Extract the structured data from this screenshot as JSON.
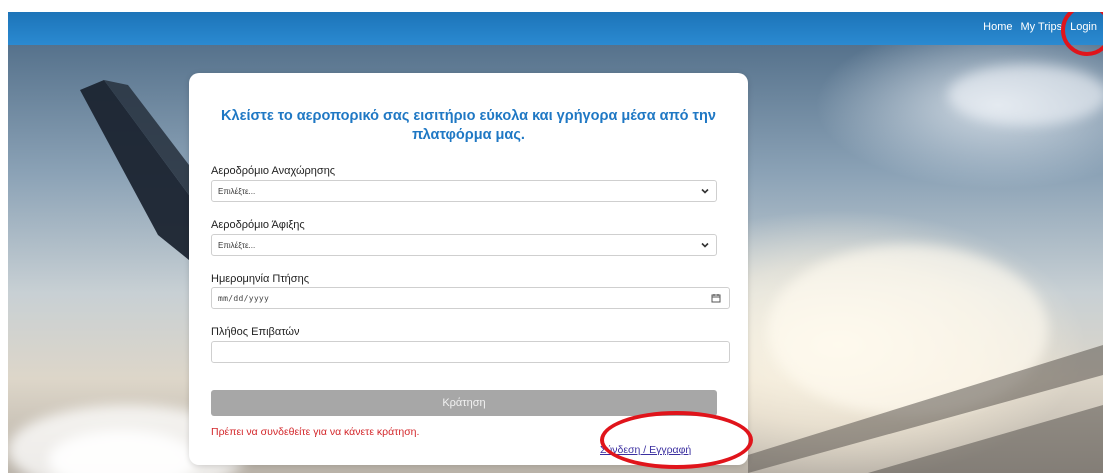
{
  "nav": {
    "links": [
      {
        "label": "Home"
      },
      {
        "label": "My Trips"
      },
      {
        "label": "Login"
      }
    ]
  },
  "form": {
    "title": "Κλείστε το αεροπορικό σας εισιτήριο εύκολα και γρήγορα μέσα από την πλατφόρμα μας.",
    "departure": {
      "label": "Αεροδρόμιο Αναχώρησης",
      "selected": "Επιλέξτε..."
    },
    "arrival": {
      "label": "Αεροδρόμιο Άφιξης",
      "selected": "Επιλέξτε..."
    },
    "date": {
      "label": "Ημερομηνία Πτήσης",
      "value": "mm/dd/yyyy"
    },
    "passengers": {
      "label": "Πλήθος Επιβατών",
      "value": ""
    },
    "submit_label": "Κράτηση",
    "error": "Πρέπει να συνδεθείτε για να κάνετε κράτηση.",
    "auth_link": "Σύνδεση / Εγγραφή"
  },
  "colors": {
    "navbar": "#1d74b8",
    "title": "#1f78c4",
    "button_disabled": "#a7a7a7",
    "error": "#d3262a",
    "link": "#3b2fa0",
    "annotation_circle": "#e0141b"
  }
}
